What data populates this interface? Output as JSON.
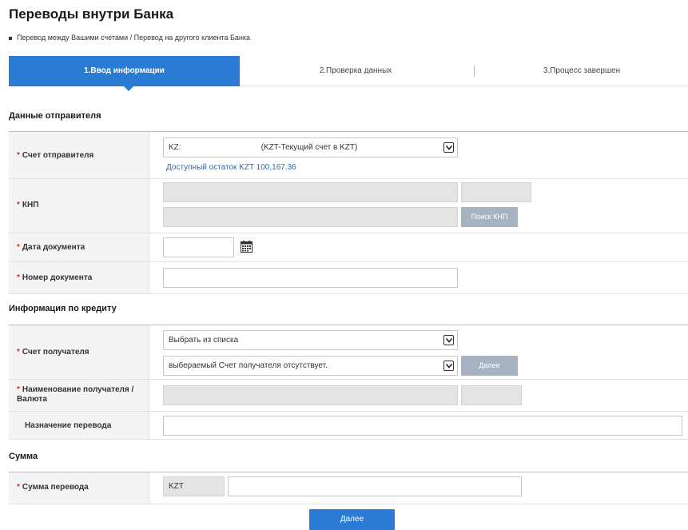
{
  "page": {
    "title": "Переводы внутри Банка",
    "subtitle": "Перевод между Вашими счетами / Перевод на другого клиента Банка"
  },
  "steps": [
    {
      "label": "1.Ввод информации"
    },
    {
      "label": "2.Проверка данных"
    },
    {
      "label": "3.Процесс завершен"
    }
  ],
  "sender": {
    "section_title": "Данные отправителя",
    "account_label": "Счет отправителя",
    "account_value": "KZ:                                    (KZT-Текущий счет в KZT)",
    "available_balance": "Доступный остаток  KZT  100,167.36",
    "knp_label": "КНП",
    "knp_search_button": "Поиск КНП",
    "doc_date_label": "Дата документа",
    "doc_number_label": "Номер документа"
  },
  "credit": {
    "section_title": "Информация по кредиту",
    "recipient_account_label": "Счет получателя",
    "recipient_select_value": "Выбрать из списка",
    "recipient_account_value": "выбераемый Счет получателя отсутствует.",
    "recipient_next_button": "Далее",
    "recipient_name_label_1": "Наименование получателя /",
    "recipient_name_label_2": "Валюта",
    "purpose_label": "Назначение перевода"
  },
  "amount": {
    "section_title": "Сумма",
    "amount_label": "Сумма перевода",
    "currency": "KZT"
  },
  "actions": {
    "next_button": "Далее"
  },
  "colors": {
    "accent": "#2a7bd3",
    "required_star": "#d2332f",
    "link": "#2a6ab3"
  }
}
